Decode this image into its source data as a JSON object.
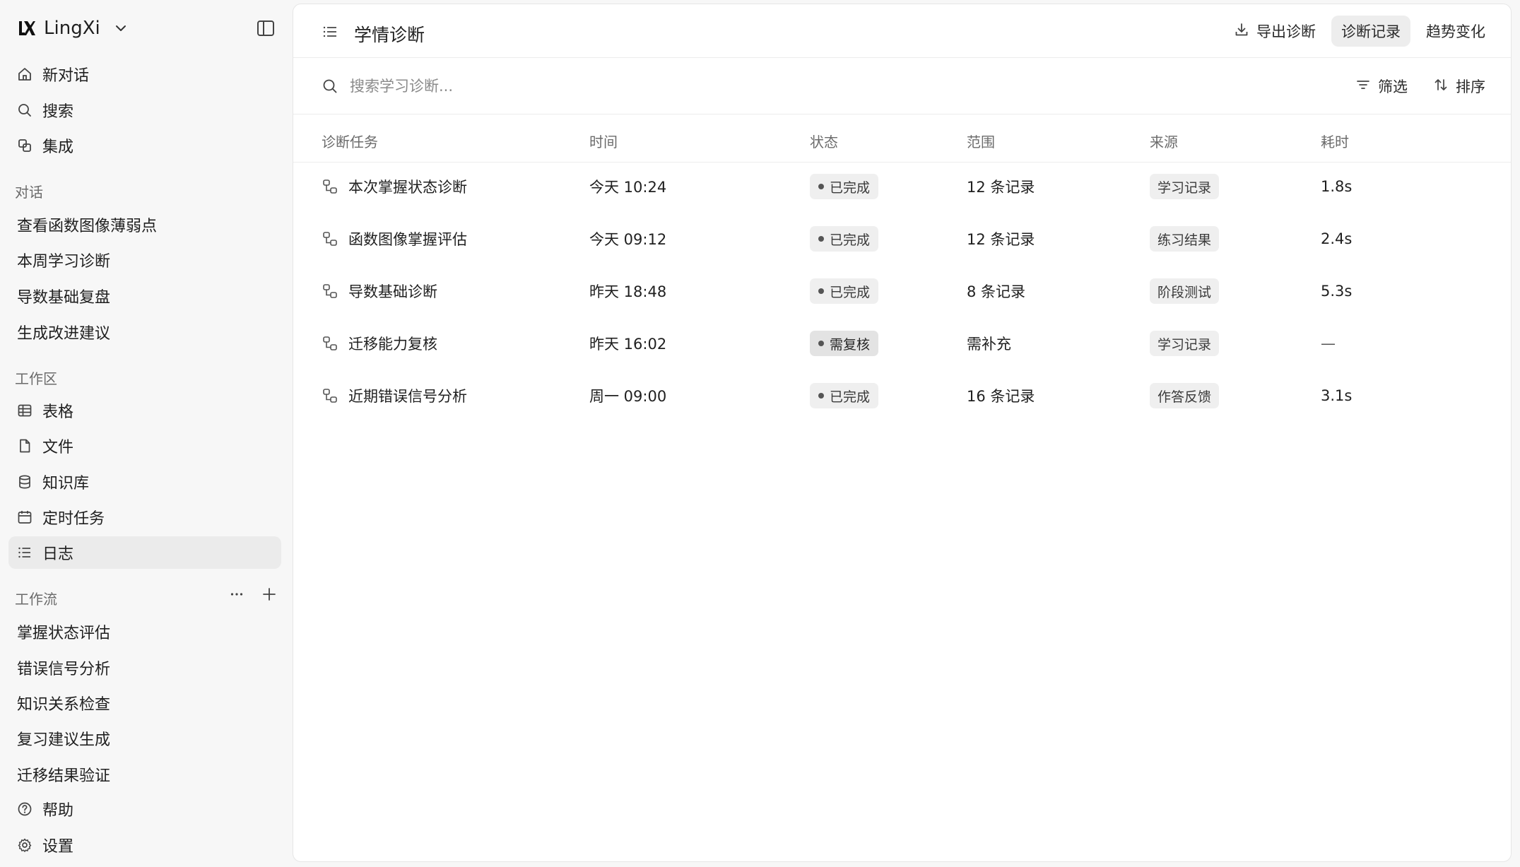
{
  "brand": {
    "name": "LingXi"
  },
  "nav_primary": [
    {
      "label": "新对话",
      "icon": "home-icon"
    },
    {
      "label": "搜索",
      "icon": "search-icon"
    },
    {
      "label": "集成",
      "icon": "integration-icon"
    }
  ],
  "sections": {
    "conversations": "对话",
    "workspace": "工作区",
    "workflows": "工作流"
  },
  "conversations": [
    {
      "label": "查看函数图像薄弱点"
    },
    {
      "label": "本周学习诊断"
    },
    {
      "label": "导数基础复盘"
    },
    {
      "label": "生成改进建议"
    }
  ],
  "workspace": [
    {
      "label": "表格",
      "icon": "table-icon"
    },
    {
      "label": "文件",
      "icon": "file-icon"
    },
    {
      "label": "知识库",
      "icon": "database-icon"
    },
    {
      "label": "定时任务",
      "icon": "calendar-icon"
    },
    {
      "label": "日志",
      "icon": "log-list-icon",
      "active": true
    }
  ],
  "workflows": [
    {
      "label": "掌握状态评估"
    },
    {
      "label": "错误信号分析"
    },
    {
      "label": "知识关系检查"
    },
    {
      "label": "复习建议生成"
    },
    {
      "label": "迁移结果验证"
    }
  ],
  "footer": {
    "help": "帮助",
    "settings": "设置"
  },
  "header": {
    "title": "学情诊断",
    "actions": {
      "export": "导出诊断",
      "records": "诊断记录",
      "trend": "趋势变化"
    }
  },
  "search": {
    "placeholder": "搜索学习诊断...",
    "filter": "筛选",
    "sort": "排序"
  },
  "table": {
    "columns": [
      "诊断任务",
      "时间",
      "状态",
      "范围",
      "来源",
      "耗时"
    ],
    "rows": [
      {
        "task": "本次掌握状态诊断",
        "time": "今天 10:24",
        "status": "已完成",
        "status_type": "done",
        "scope": "12 条记录",
        "source": "学习记录",
        "duration": "1.8s"
      },
      {
        "task": "函数图像掌握评估",
        "time": "今天 09:12",
        "status": "已完成",
        "status_type": "done",
        "scope": "12 条记录",
        "source": "练习结果",
        "duration": "2.4s"
      },
      {
        "task": "导数基础诊断",
        "time": "昨天 18:48",
        "status": "已完成",
        "status_type": "done",
        "scope": "8 条记录",
        "source": "阶段测试",
        "duration": "5.3s"
      },
      {
        "task": "迁移能力复核",
        "time": "昨天 16:02",
        "status": "需复核",
        "status_type": "review",
        "scope": "需补充",
        "source": "学习记录",
        "duration": "—"
      },
      {
        "task": "近期错误信号分析",
        "time": "周一 09:00",
        "status": "已完成",
        "status_type": "done",
        "scope": "16 条记录",
        "source": "作答反馈",
        "duration": "3.1s"
      }
    ]
  }
}
